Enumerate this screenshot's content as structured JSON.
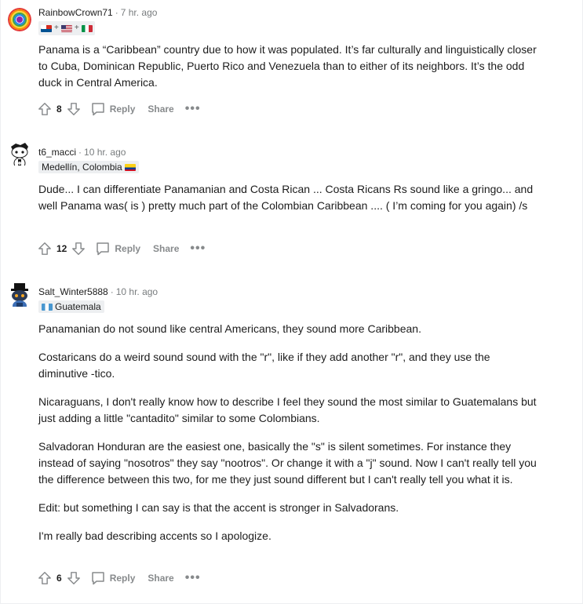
{
  "comments": [
    {
      "username": "RainbowCrown71",
      "time": "7 hr. ago",
      "flair": "",
      "flair_flags": [
        "panama",
        "usa",
        "italy"
      ],
      "paragraphs": [
        "Panama is a “Caribbean” country due to how it was populated. It’s far culturally and linguistically closer to Cuba, Dominican Republic, Puerto Rico and Venezuela than to either of its neighbors. It’s the odd duck in Central America."
      ],
      "score": "8"
    },
    {
      "username": "t6_macci",
      "time": "10 hr. ago",
      "flair": "Medellín, Colombia",
      "flair_flags": [
        "colombia"
      ],
      "paragraphs": [
        "Dude... I can differentiate Panamanian and Costa Rican ... Costa Ricans Rs sound like a gringo... and well Panama was( is ) pretty much part of the Colombian Caribbean .... ( I’m coming for you again) /s"
      ],
      "score": "12"
    },
    {
      "username": "Salt_Winter5888",
      "time": "10 hr. ago",
      "flair": "Guatemala",
      "flair_flags": [
        "guatemala"
      ],
      "paragraphs": [
        "Panamanian do not sound like central Americans, they sound more Caribbean.",
        "Costaricans do a weird sound sound with the \"r\", like if they add another \"r\", and they use the diminutive -tico.",
        "Nicaraguans, I don't really know how to describe I feel they sound the most similar to Guatemalans but just adding a little \"cantadito\" similar to some Colombians.",
        "Salvadoran Honduran are the easiest one, basically the \"s\" is silent sometimes. For instance they instead of saying \"nosotros\" they say \"nootros\". Or change it with a \"j\" sound. Now I can't really tell you the difference between this two, for me they just sound different but I can't really tell you what it is.",
        "Edit: but something I can say is that the accent is stronger in Salvadorans.",
        "I'm really bad describing accents so I apologize."
      ],
      "score": "6"
    }
  ],
  "actions": {
    "reply": "Reply",
    "share": "Share",
    "more": "•••"
  },
  "colors": {
    "meta": "#787c7e",
    "action": "#878a8c",
    "flair_bg": "#edeff1",
    "divider": "#edeff1"
  }
}
